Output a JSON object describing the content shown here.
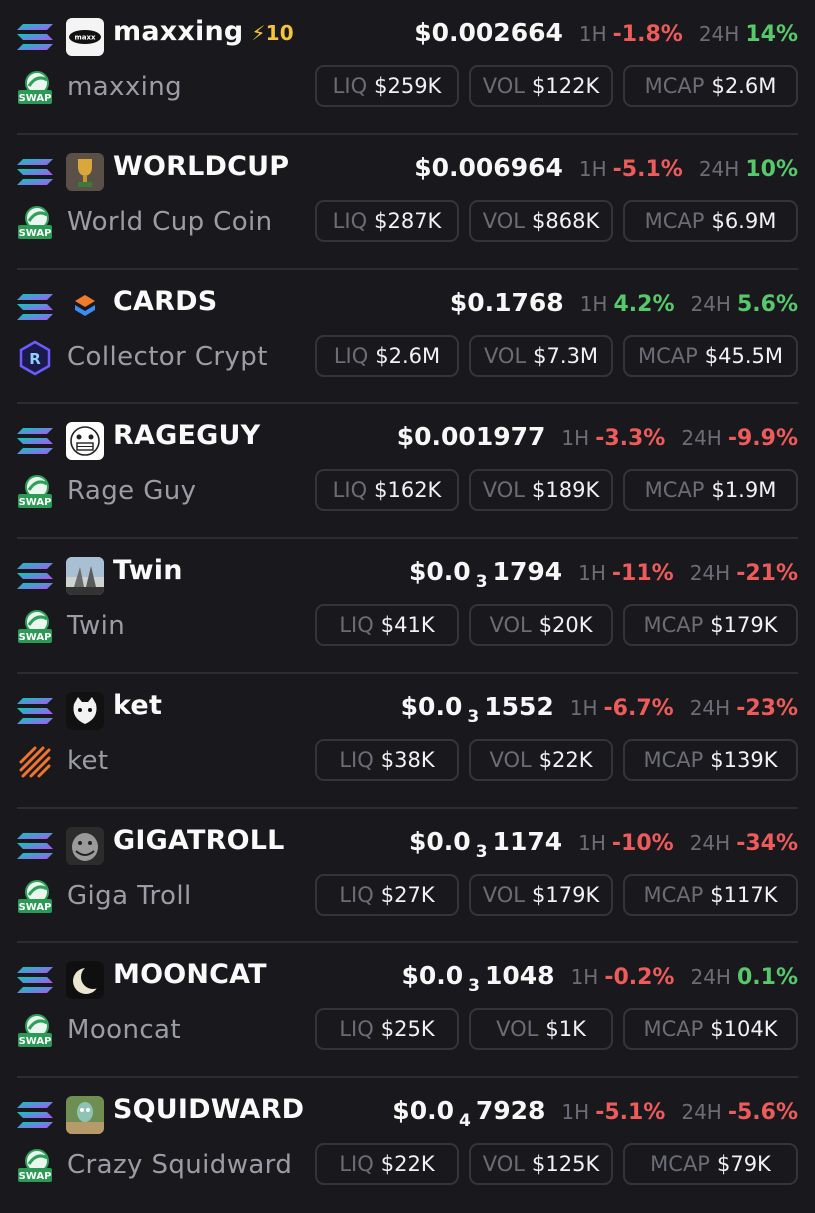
{
  "labels": {
    "h1": "1H",
    "h24": "24H",
    "liq": "LIQ",
    "vol": "VOL",
    "mcap": "MCAP"
  },
  "colors": {
    "negative": "#ee5b5b",
    "positive": "#56c96b",
    "boost": "#f3c53a"
  },
  "tokens": [
    {
      "symbol": "maxxing",
      "boost": "⚡10",
      "name": "maxxing",
      "price_main": "$0.002664",
      "price_zeros": "",
      "price_tail": "",
      "change_1h": "-1.8%",
      "change_24h": "14%",
      "liq": "$259K",
      "vol": "$122K",
      "mcap": "$2.6M",
      "dex_icon": "swap-icon",
      "avatar_icon": "maxxing-logo-icon"
    },
    {
      "symbol": "WORLDCUP",
      "boost": "",
      "name": "World Cup Coin",
      "price_main": "$0.006964",
      "price_zeros": "",
      "price_tail": "",
      "change_1h": "-5.1%",
      "change_24h": "10%",
      "liq": "$287K",
      "vol": "$868K",
      "mcap": "$6.9M",
      "dex_icon": "swap-icon",
      "avatar_icon": "trophy-icon"
    },
    {
      "symbol": "CARDS",
      "boost": "",
      "name": "Collector Crypt",
      "price_main": "$0.1768",
      "price_zeros": "",
      "price_tail": "",
      "change_1h": "4.2%",
      "change_24h": "5.6%",
      "liq": "$2.6M",
      "vol": "$7.3M",
      "mcap": "$45.5M",
      "dex_icon": "raydium-icon",
      "avatar_icon": "cards-icon"
    },
    {
      "symbol": "RAGEGUY",
      "boost": "",
      "name": "Rage Guy",
      "price_main": "$0.001977",
      "price_zeros": "",
      "price_tail": "",
      "change_1h": "-3.3%",
      "change_24h": "-9.9%",
      "liq": "$162K",
      "vol": "$189K",
      "mcap": "$1.9M",
      "dex_icon": "swap-icon",
      "avatar_icon": "rage-face-icon"
    },
    {
      "symbol": "Twin",
      "boost": "",
      "name": "Twin",
      "price_main": "$0.0",
      "price_zeros": "3",
      "price_tail": "1794",
      "change_1h": "-11%",
      "change_24h": "-21%",
      "liq": "$41K",
      "vol": "$20K",
      "mcap": "$179K",
      "dex_icon": "swap-icon",
      "avatar_icon": "twin-image-icon"
    },
    {
      "symbol": "ket",
      "boost": "",
      "name": "ket",
      "price_main": "$0.0",
      "price_zeros": "3",
      "price_tail": "1552",
      "change_1h": "-6.7%",
      "change_24h": "-23%",
      "liq": "$38K",
      "vol": "$22K",
      "mcap": "$139K",
      "dex_icon": "stripes-icon",
      "avatar_icon": "cat-icon"
    },
    {
      "symbol": "GIGATROLL",
      "boost": "",
      "name": "Giga Troll",
      "price_main": "$0.0",
      "price_zeros": "3",
      "price_tail": "1174",
      "change_1h": "-10%",
      "change_24h": "-34%",
      "liq": "$27K",
      "vol": "$179K",
      "mcap": "$117K",
      "dex_icon": "swap-icon",
      "avatar_icon": "troll-face-icon"
    },
    {
      "symbol": "MOONCAT",
      "boost": "",
      "name": "Mooncat",
      "price_main": "$0.0",
      "price_zeros": "3",
      "price_tail": "1048",
      "change_1h": "-0.2%",
      "change_24h": "0.1%",
      "liq": "$25K",
      "vol": "$1K",
      "mcap": "$104K",
      "dex_icon": "swap-icon",
      "avatar_icon": "moon-icon"
    },
    {
      "symbol": "SQUIDWARD",
      "boost": "",
      "name": "Crazy Squidward",
      "price_main": "$0.0",
      "price_zeros": "4",
      "price_tail": "7928",
      "change_1h": "-5.1%",
      "change_24h": "-5.6%",
      "liq": "$22K",
      "vol": "$125K",
      "mcap": "$79K",
      "dex_icon": "swap-icon",
      "avatar_icon": "squidward-image-icon"
    }
  ]
}
